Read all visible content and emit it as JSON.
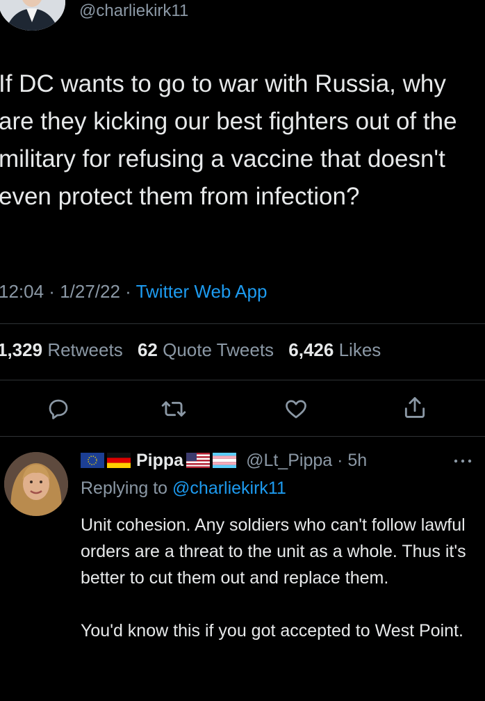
{
  "tweet": {
    "handle": "@charliekirk11",
    "text": "If DC wants to go to war with Russia, why are they kicking our best fighters out of the military for refusing a vaccine that doesn't even protect them from infection?",
    "time": "12:04",
    "date": "1/27/22",
    "source": "Twitter Web App",
    "sep": " · "
  },
  "stats": {
    "retweets_count": "1,329",
    "retweets_label": "Retweets",
    "quotes_count": "62",
    "quotes_label": "Quote Tweets",
    "likes_count": "6,426",
    "likes_label": "Likes"
  },
  "actions": [
    {
      "icon": "reply-icon"
    },
    {
      "icon": "retweet-icon"
    },
    {
      "icon": "like-icon"
    },
    {
      "icon": "share-icon"
    }
  ],
  "reply": {
    "name": "Pippa",
    "handle": "@Lt_Pippa",
    "time": "5h",
    "sep": " · ",
    "replying_prefix": "Replying to ",
    "replying_to": "@charliekirk11",
    "paragraphs": [
      "Unit cohesion. Any soldiers who can't follow lawful orders are a threat to the unit as a whole. Thus it's better to cut them out and replace them.",
      "You'd know this if you got accepted to West Point."
    ],
    "flags_before_name": [
      "eu-flag-icon",
      "germany-flag-icon"
    ],
    "flags_after_name": [
      "us-flag-icon",
      "transgender-flag-icon"
    ],
    "more_icon": "more-icon"
  },
  "colors": {
    "background": "#000000",
    "text": "#e7e9ea",
    "secondary": "#8b98a5",
    "link": "#1d9bf0",
    "divider": "#2f3336"
  }
}
